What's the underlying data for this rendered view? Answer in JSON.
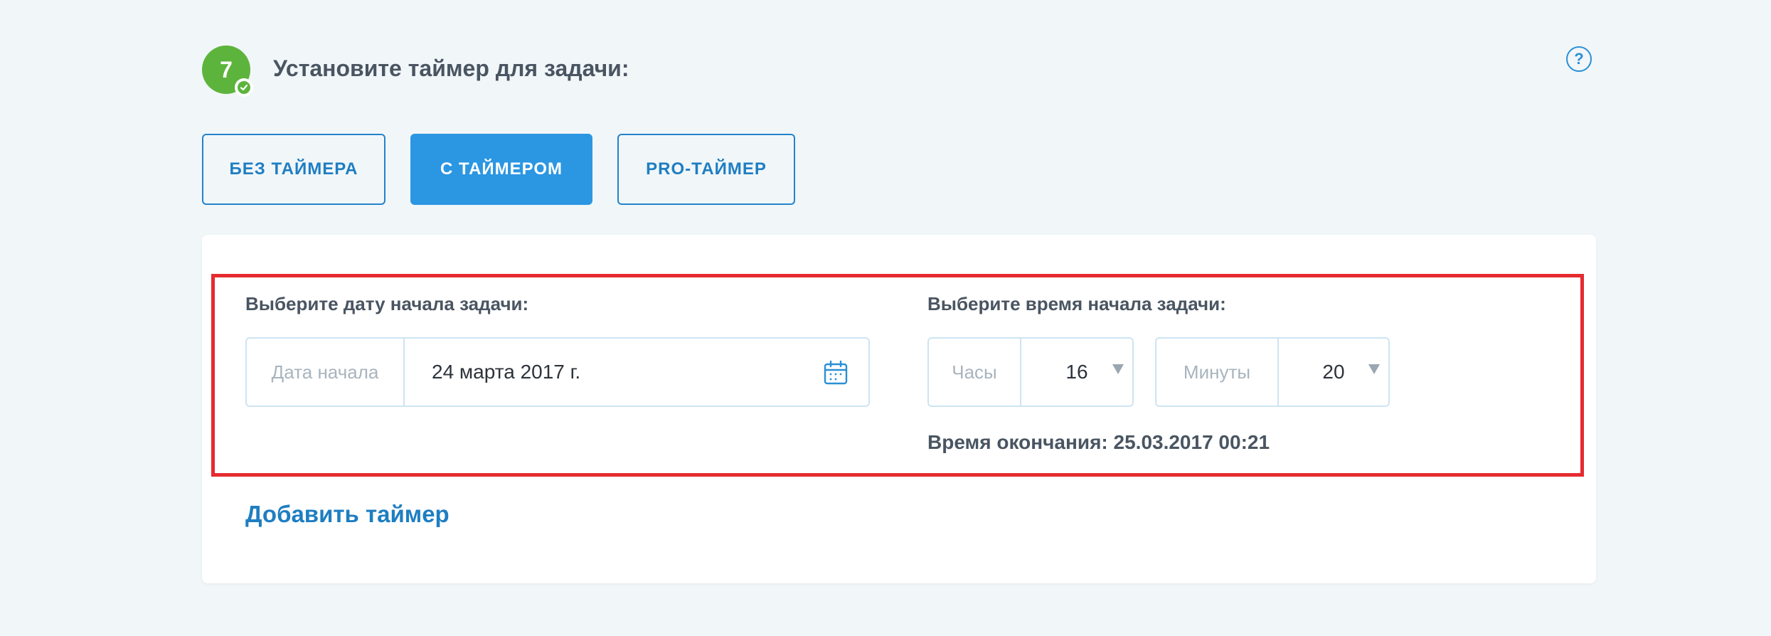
{
  "step": {
    "number": "7",
    "title": "Установите таймер для задачи:"
  },
  "help": {
    "icon": "?"
  },
  "modes": [
    {
      "label": "БЕЗ ТАЙМЕРА",
      "active": false
    },
    {
      "label": "С ТАЙМЕРОМ",
      "active": true
    },
    {
      "label": "PRO-ТАЙМЕР",
      "active": false
    }
  ],
  "date_section": {
    "label": "Выберите дату начала задачи:",
    "addon": "Дата начала",
    "value": "24 марта 2017 г."
  },
  "time_section": {
    "label": "Выберите время начала задачи:",
    "hours_addon": "Часы",
    "hours_value": "16",
    "minutes_addon": "Минуты",
    "minutes_value": "20",
    "end_time": "Время окончания: 25.03.2017 00:21"
  },
  "add_timer": "Добавить таймер",
  "colors": {
    "accent": "#2b96e2",
    "step_badge": "#5db43c",
    "highlight": "#e52b2f"
  }
}
